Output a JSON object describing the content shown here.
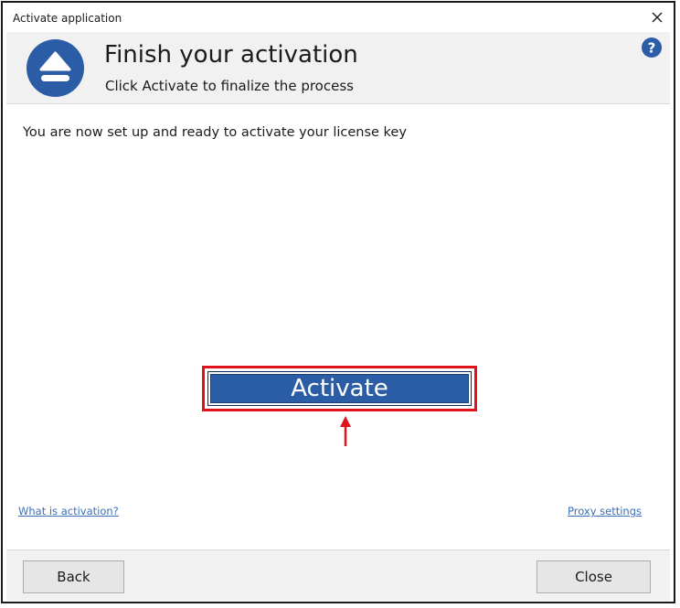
{
  "window": {
    "title": "Activate application"
  },
  "header": {
    "title": "Finish your activation",
    "subtitle": "Click Activate to finalize the process",
    "logo_icon": "eject-icon",
    "help_icon": "help-icon",
    "accent_color": "#2b5da6"
  },
  "content": {
    "intro_text": "You are now set up and ready to activate your license key",
    "activate_label": "Activate",
    "highlight_color": "#e0121c",
    "left_link": "What is activation?",
    "right_link": "Proxy settings"
  },
  "footer": {
    "back_label": "Back",
    "close_label": "Close"
  }
}
